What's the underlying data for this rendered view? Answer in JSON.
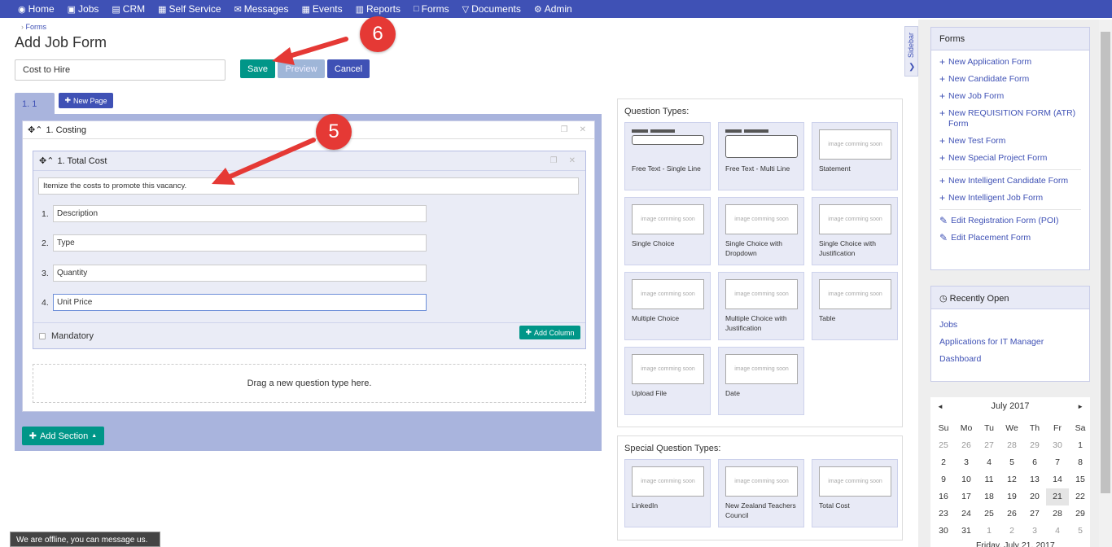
{
  "nav": [
    {
      "icon": "◉",
      "label": "Home"
    },
    {
      "icon": "▣",
      "label": "Jobs"
    },
    {
      "icon": "▤",
      "label": "CRM"
    },
    {
      "icon": "▦",
      "label": "Self Service"
    },
    {
      "icon": "✉",
      "label": "Messages"
    },
    {
      "icon": "▦",
      "label": "Events"
    },
    {
      "icon": "▥",
      "label": "Reports"
    },
    {
      "icon": "□",
      "label": "Forms"
    },
    {
      "icon": "▽",
      "label": "Documents"
    },
    {
      "icon": "⚙",
      "label": "Admin"
    }
  ],
  "breadcrumb": "Forms",
  "page_title": "Add Job Form",
  "form_name": "Cost to Hire",
  "buttons": {
    "save": "Save",
    "preview": "Preview",
    "cancel": "Cancel",
    "new_page": "New Page",
    "add_section": "Add Section",
    "add_column": "Add Column"
  },
  "page_tab": "1. 1",
  "section": {
    "title": "1. Costing"
  },
  "question": {
    "title": "1. Total Cost",
    "description": "Itemize the costs to promote this vacancy.",
    "columns": [
      {
        "num": "1.",
        "value": "Description"
      },
      {
        "num": "2.",
        "value": "Type"
      },
      {
        "num": "3.",
        "value": "Quantity"
      },
      {
        "num": "4.",
        "value": "Unit Price"
      }
    ],
    "mandatory_label": "Mandatory"
  },
  "dropzone_text": "Drag a new question type here.",
  "question_types_title": "Question Types:",
  "question_types": [
    {
      "label": "Free Text - Single Line",
      "thumb": ""
    },
    {
      "label": "Free Text - Multi Line",
      "thumb": ""
    },
    {
      "label": "Statement",
      "thumb": "image comming soon"
    },
    {
      "label": "Single Choice",
      "thumb": "image comming soon"
    },
    {
      "label": "Single Choice with Dropdown",
      "thumb": "image comming soon"
    },
    {
      "label": "Single Choice with Justification",
      "thumb": "image comming soon"
    },
    {
      "label": "Multiple Choice",
      "thumb": "image comming soon"
    },
    {
      "label": "Multiple Choice with Justification",
      "thumb": "image comming soon"
    },
    {
      "label": "Table",
      "thumb": "image comming soon"
    },
    {
      "label": "Upload File",
      "thumb": "image comming soon"
    },
    {
      "label": "Date",
      "thumb": "image comming soon"
    }
  ],
  "special_types_title": "Special Question Types:",
  "special_types": [
    {
      "label": "LinkedIn",
      "thumb": "image comming soon"
    },
    {
      "label": "New Zealand Teachers Council",
      "thumb": "image comming soon"
    },
    {
      "label": "Total Cost",
      "thumb": "image comming soon"
    }
  ],
  "sidebar_toggle": "Sidebar",
  "forms_card": {
    "title": "Forms",
    "group1": [
      "New Application Form",
      "New Candidate Form",
      "New Job Form",
      "New REQUISITION FORM (ATR) Form",
      "New Test Form",
      "New Special Project Form"
    ],
    "group2": [
      "New Intelligent Candidate Form",
      "New Intelligent Job Form"
    ],
    "group3": [
      "Edit Registration Form (POI)",
      "Edit Placement Form"
    ]
  },
  "recent_card": {
    "title": "Recently Open",
    "items": [
      "Jobs",
      "Applications for IT Manager",
      "Dashboard"
    ]
  },
  "calendar": {
    "month": "July 2017",
    "dow": [
      "Su",
      "Mo",
      "Tu",
      "We",
      "Th",
      "Fr",
      "Sa"
    ],
    "days": [
      [
        "25",
        "26",
        "27",
        "28",
        "29",
        "30",
        "1"
      ],
      [
        "2",
        "3",
        "4",
        "5",
        "6",
        "7",
        "8"
      ],
      [
        "9",
        "10",
        "11",
        "12",
        "13",
        "14",
        "15"
      ],
      [
        "16",
        "17",
        "18",
        "19",
        "20",
        "21",
        "22"
      ],
      [
        "23",
        "24",
        "25",
        "26",
        "27",
        "28",
        "29"
      ],
      [
        "30",
        "31",
        "1",
        "2",
        "3",
        "4",
        "5"
      ]
    ],
    "footer": "Friday, July 21, 2017"
  },
  "offline_text": "We are offline, you can message us.",
  "callouts": {
    "five": "5",
    "six": "6"
  },
  "colors": {
    "nav": "#3f51b5",
    "teal": "#009688",
    "callout": "#e53935"
  }
}
